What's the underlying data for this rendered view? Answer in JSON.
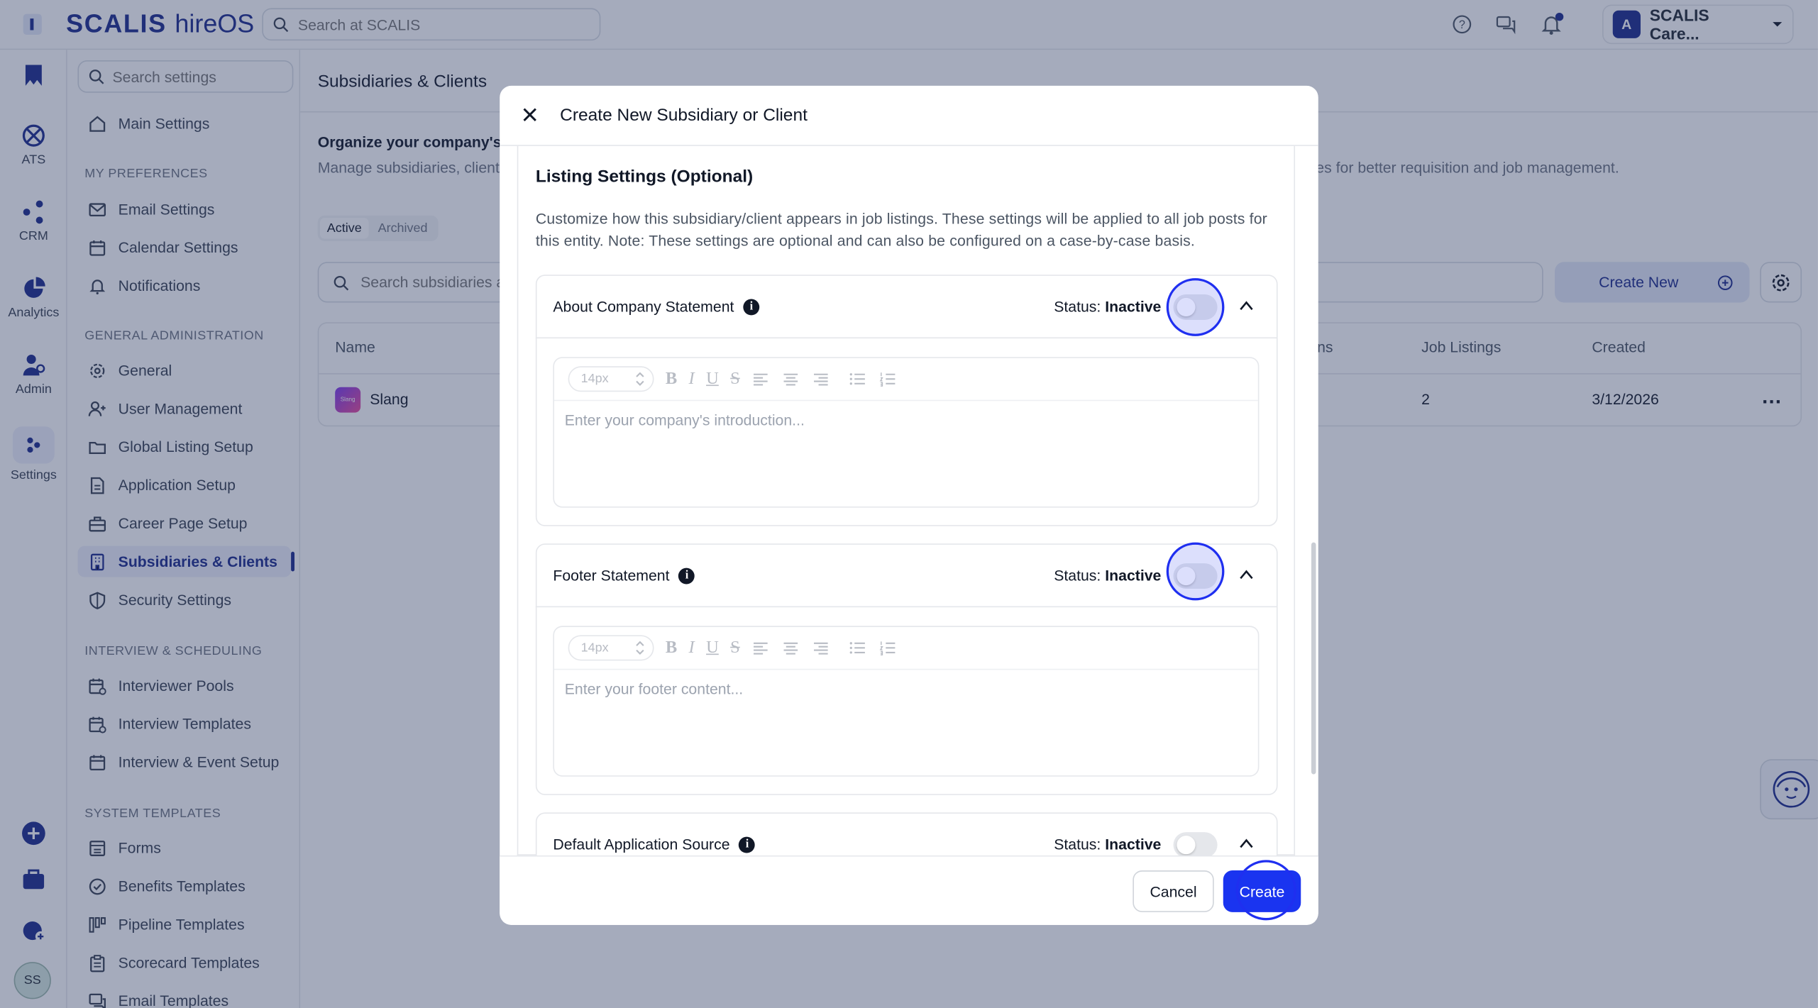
{
  "topbar": {
    "brand_name": "SCALIS",
    "brand_suffix": "hireOS",
    "search_placeholder": "Search at SCALIS",
    "account_name": "SCALIS Care...",
    "account_logo": "A"
  },
  "rail": {
    "items": [
      {
        "label": "ATS",
        "icon": "ats-icon"
      },
      {
        "label": "CRM",
        "icon": "crm-icon"
      },
      {
        "label": "Analytics",
        "icon": "analytics-icon"
      },
      {
        "label": "Admin",
        "icon": "admin-icon"
      },
      {
        "label": "Settings",
        "icon": "settings-icon"
      }
    ],
    "avatar_initials": "SS"
  },
  "sidebar": {
    "search_placeholder": "Search settings",
    "main_settings": "Main Settings",
    "sections": [
      {
        "title": "MY PREFERENCES",
        "items": [
          "Email Settings",
          "Calendar Settings",
          "Notifications"
        ]
      },
      {
        "title": "GENERAL ADMINISTRATION",
        "items": [
          "General",
          "User Management",
          "Global Listing Setup",
          "Application Setup",
          "Career Page Setup",
          "Subsidiaries & Clients",
          "Security Settings"
        ]
      },
      {
        "title": "INTERVIEW & SCHEDULING",
        "items": [
          "Interviewer Pools",
          "Interview Templates",
          "Interview & Event Setup"
        ]
      },
      {
        "title": "SYSTEM TEMPLATES",
        "items": [
          "Forms",
          "Benefits Templates",
          "Pipeline Templates",
          "Scorecard Templates",
          "Email Templates"
        ]
      }
    ],
    "active_item": "Subsidiaries & Clients"
  },
  "main": {
    "title": "Subsidiaries & Clients",
    "org_title": "Organize your company's st",
    "org_desc_left": "Manage subsidiaries, clients",
    "org_desc_right": "ies for better requisition and job management.",
    "tabs": [
      "Active",
      "Archived"
    ],
    "active_tab": "Active",
    "search_placeholder": "Search subsidiaries a",
    "create_new_label": "Create New",
    "table": {
      "headers": [
        "Name",
        "ns",
        "Job Listings",
        "Created"
      ],
      "rows": [
        {
          "logo_text": "Slang",
          "name": "Slang",
          "job_listings": "2",
          "created": "3/12/2026",
          "menu": "…"
        }
      ]
    }
  },
  "modal": {
    "title": "Create New Subsidiary or Client",
    "section_title": "Listing Settings (Optional)",
    "section_desc": "Customize how this subsidiary/client appears in job listings. These settings will be applied to all job posts for this entity. Note: These settings are optional and can also be configured on a case-by-case basis.",
    "status_prefix": "Status:",
    "cards": [
      {
        "label": "About Company Statement",
        "status": "Inactive",
        "enabled": false,
        "font_size": "14px",
        "placeholder": "Enter your company's introduction..."
      },
      {
        "label": "Footer Statement",
        "status": "Inactive",
        "enabled": false,
        "font_size": "14px",
        "placeholder": "Enter your footer content..."
      },
      {
        "label": "Default Application Source",
        "status": "Inactive",
        "enabled": false
      }
    ],
    "cancel_label": "Cancel",
    "create_label": "Create"
  },
  "colors": {
    "brand": "#1a2a8c",
    "primary_button": "#1a34f0",
    "overlay": "#28375f"
  }
}
